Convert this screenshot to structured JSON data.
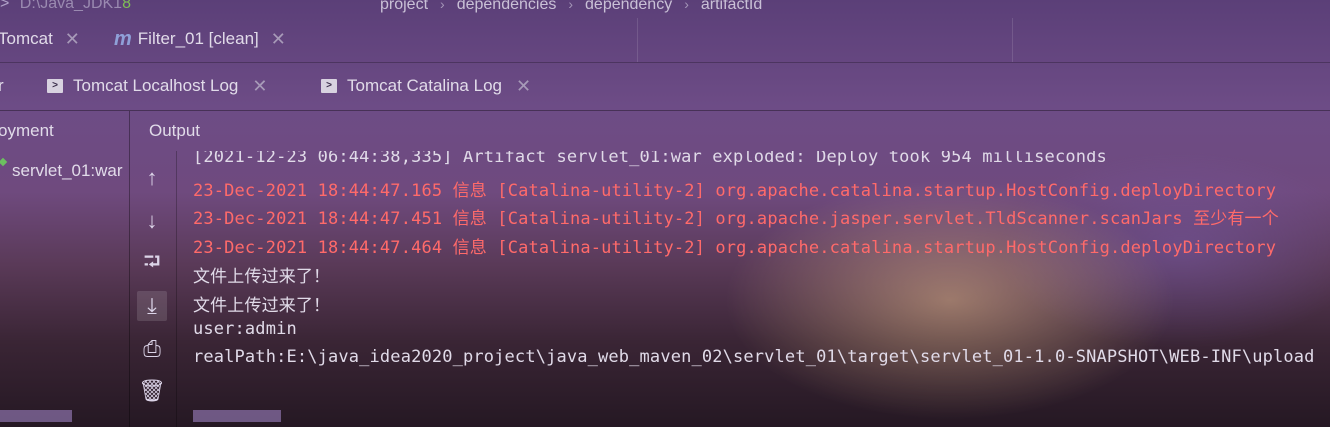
{
  "topbar": {
    "project_path": "D:\\Java_JDK1",
    "project_path_num": "8",
    "breadcrumbs": [
      "project",
      "dependencies",
      "dependency",
      "artifactId"
    ]
  },
  "run_tabs": [
    {
      "label": "Tomcat",
      "icon": "none"
    },
    {
      "label": "Filter_01 [clean]",
      "icon": "maven-icon"
    }
  ],
  "maven_icon_glyph": "m",
  "server_tabs": [
    {
      "label": "r"
    },
    {
      "label": "Tomcat Localhost Log",
      "icon": "terminal-icon"
    },
    {
      "label": "Tomcat Catalina Log",
      "icon": "terminal-icon"
    }
  ],
  "close_glyph": "✕",
  "deployment": {
    "title": "oyment",
    "item": "servlet_01:war"
  },
  "output": {
    "title": "Output",
    "lines": [
      {
        "text": "[2021-12-23 06:44:38,335] Artifact servlet_01:war exploded: Deploy took 954 milliseconds",
        "color": "gray"
      },
      {
        "text": "23-Dec-2021 18:44:47.165 信息 [Catalina-utility-2] org.apache.catalina.startup.HostConfig.deployDirectory",
        "color": "red"
      },
      {
        "text": "23-Dec-2021 18:44:47.451 信息 [Catalina-utility-2] org.apache.jasper.servlet.TldScanner.scanJars 至少有一个",
        "color": "red"
      },
      {
        "text": "23-Dec-2021 18:44:47.464 信息 [Catalina-utility-2] org.apache.catalina.startup.HostConfig.deployDirectory",
        "color": "red"
      },
      {
        "text": "文件上传过来了！",
        "color": "gray"
      },
      {
        "text": "文件上传过来了！",
        "color": "gray"
      },
      {
        "text": "user:admin",
        "color": "gray"
      },
      {
        "text": "realPath:E:\\java_idea2020_project\\java_web_maven_02\\servlet_01\\target\\servlet_01-1.0-SNAPSHOT\\WEB-INF\\upload",
        "color": "gray"
      }
    ]
  },
  "toolbar": [
    {
      "name": "scroll-up-icon",
      "glyph": "↑"
    },
    {
      "name": "scroll-down-icon",
      "glyph": "↓"
    },
    {
      "name": "soft-wrap-icon",
      "glyph": "⮒"
    },
    {
      "name": "scroll-to-end-icon",
      "glyph": "⤓"
    },
    {
      "name": "print-icon",
      "glyph": "⎙"
    },
    {
      "name": "trash-icon",
      "glyph": "🗑"
    }
  ],
  "colors": {
    "log_red": "#ff6a6a",
    "log_gray": "#e0dae8",
    "accent_green": "#7fbf55"
  }
}
